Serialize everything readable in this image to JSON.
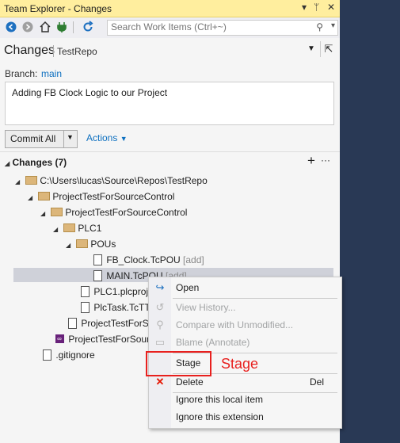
{
  "window": {
    "title": "Team Explorer - Changes",
    "controls": [
      "▾",
      "ᛘ",
      "✕"
    ]
  },
  "toolbar": {
    "search_placeholder": "Search Work Items (Ctrl+~)"
  },
  "header": {
    "title": "Changes",
    "repo": "TestRepo"
  },
  "branch": {
    "label": "Branch:",
    "value": "main"
  },
  "commit_message": "Adding FB Clock Logic to our Project",
  "commit_button": "Commit All",
  "actions_label": "Actions",
  "changes_header": "Changes (7)",
  "tree": {
    "root": "C:\\Users\\lucas\\Source\\Repos\\TestRepo",
    "project1": "ProjectTestForSourceControl",
    "project2": "ProjectTestForSourceControl",
    "plc1": "PLC1",
    "pous": "POUs",
    "fb_clock": "FB_Clock.TcPOU",
    "fb_clock_tag": "[add]",
    "main": "MAIN.TcPOU",
    "main_tag": "[add]",
    "plcproj": "PLC1.plcproj",
    "plctask": "PlcTask.TcTTO",
    "projfile": "ProjectTestForSo",
    "slnfile": "ProjectTestForSource",
    "gitignore": ".gitignore"
  },
  "menu": {
    "open": "Open",
    "history": "View History...",
    "compare": "Compare with Unmodified...",
    "blame": "Blame (Annotate)",
    "stage": "Stage",
    "delete": "Delete",
    "delete_shortcut": "Del",
    "ignore_item": "Ignore this local item",
    "ignore_ext": "Ignore this extension"
  },
  "annotation": {
    "label": "Stage",
    "color": "#e8201e"
  },
  "colors": {
    "accent": "#0e70c0",
    "titlebar": "#ffee9e",
    "background": "#293955"
  }
}
